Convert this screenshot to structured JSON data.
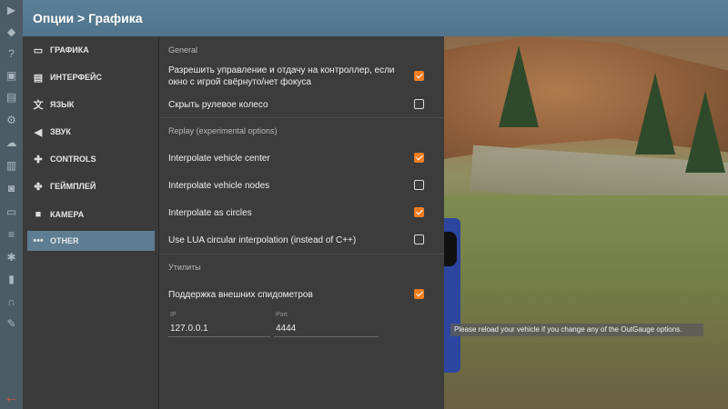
{
  "header": {
    "breadcrumb": "Опции > Графика"
  },
  "rail": {
    "icons": [
      "play-icon",
      "layers-icon",
      "help-icon",
      "briefcase-icon",
      "car-icon",
      "settings-box-icon",
      "cloud-icon",
      "film-icon",
      "camera-icon",
      "window-icon",
      "sliders-icon",
      "bug-icon",
      "chart-icon",
      "headphones-icon",
      "tools-icon"
    ],
    "exit_icon": "exit-arrow-icon"
  },
  "menu": {
    "items": [
      {
        "label": "ГРАФИКА",
        "icon": "monitor-icon",
        "active": false
      },
      {
        "label": "ИНТЕРФЕЙС",
        "icon": "interface-icon",
        "active": false
      },
      {
        "label": "ЯЗЫК",
        "icon": "translate-icon",
        "active": false
      },
      {
        "label": "ЗВУК",
        "icon": "speaker-icon",
        "active": false
      },
      {
        "label": "CONTROLS",
        "icon": "gamepad-icon",
        "active": false
      },
      {
        "label": "ГЕЙМПЛЕЙ",
        "icon": "puzzle-icon",
        "active": false
      },
      {
        "label": "КАМЕРА",
        "icon": "videocam-icon",
        "active": false
      },
      {
        "label": "OTHER",
        "icon": "more-icon",
        "active": true
      }
    ]
  },
  "panel": {
    "section_general": "General",
    "opt_controller": "Разрешить управление и отдачу на контроллер, если окно с игрой свёрнуто/нет фокуса",
    "opt_controller_checked": true,
    "opt_wheel": "Скрыть рулевое колесо",
    "opt_wheel_checked": false,
    "section_replay": "Replay (experimental options)",
    "opt_center": "Interpolate vehicle center",
    "opt_center_checked": true,
    "opt_nodes": "Interpolate vehicle nodes",
    "opt_nodes_checked": false,
    "opt_circles": "Interpolate as circles",
    "opt_circles_checked": true,
    "opt_lua": "Use LUA circular interpolation (instead of C++)",
    "opt_lua_checked": false,
    "section_utils": "Утилиты",
    "opt_speedo": "Поддержка внешних спидометров",
    "opt_speedo_checked": true,
    "ip_label": "IP",
    "ip_value": "127.0.0.1",
    "port_label": "Port",
    "port_value": "4444"
  },
  "tooltip": "Please reload your vehicle if you change any of the OutGauge options."
}
